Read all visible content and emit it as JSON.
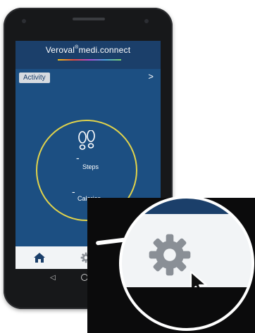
{
  "app": {
    "brand": "Veroval",
    "brand_mark": "®",
    "brand_suffix": "medi.connect"
  },
  "screen": {
    "tab_label": "Activity",
    "next_label": ">",
    "steps_value": "-",
    "steps_label": "Steps",
    "calories_value": "-",
    "calories_label": "Calories"
  },
  "bottom_bar": {
    "home_icon": "home-icon",
    "settings_icon": "gear-icon"
  },
  "system_nav": {
    "back": "◁",
    "home": "○"
  },
  "colors": {
    "header": "#1b3f6a",
    "background": "#1c4f82",
    "ring": "#e2d44b",
    "tabbar": "#f2f4f6"
  }
}
